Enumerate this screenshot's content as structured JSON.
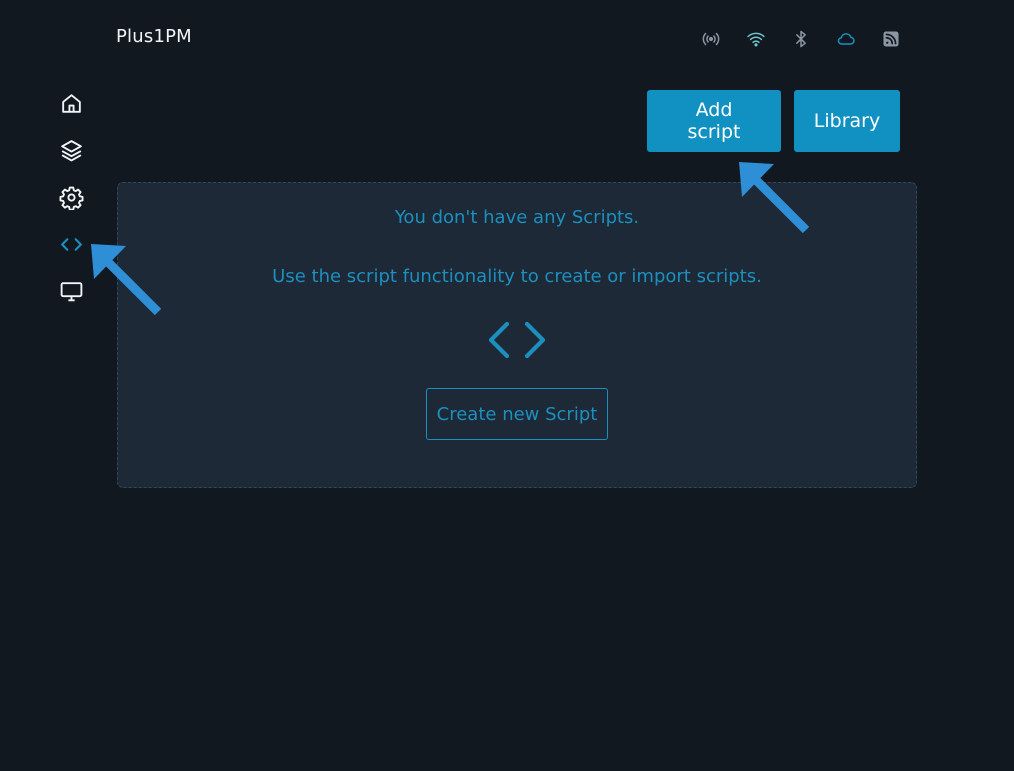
{
  "header": {
    "device_name": "Plus1PM",
    "status_icons": [
      {
        "icon": "broadcast-icon",
        "color": "#8a96a3"
      },
      {
        "icon": "wifi-icon",
        "color": "#6fc3ce"
      },
      {
        "icon": "bluetooth-icon",
        "color": "#8a96a3"
      },
      {
        "icon": "cloud-icon",
        "color": "#1d8fbf"
      },
      {
        "icon": "rss-icon",
        "color": "#8a96a3"
      }
    ]
  },
  "sidebar": {
    "items": [
      {
        "icon": "home-icon",
        "active": false
      },
      {
        "icon": "layers-icon",
        "active": false
      },
      {
        "icon": "gear-icon",
        "active": false
      },
      {
        "icon": "code-icon",
        "active": true
      },
      {
        "icon": "monitor-icon",
        "active": false
      }
    ]
  },
  "toolbar": {
    "add_script_label": "Add script",
    "library_label": "Library"
  },
  "empty_state": {
    "title": "You don't have any Scripts.",
    "subtitle": "Use the script functionality to create or import scripts.",
    "icon": "code-icon",
    "create_button_label": "Create new Script"
  },
  "colors": {
    "background": "#111820",
    "panel": "#1d2936",
    "accent": "#1191c1",
    "accent_text": "#1d8fbf",
    "annotation_arrow": "#2e8fd6"
  }
}
